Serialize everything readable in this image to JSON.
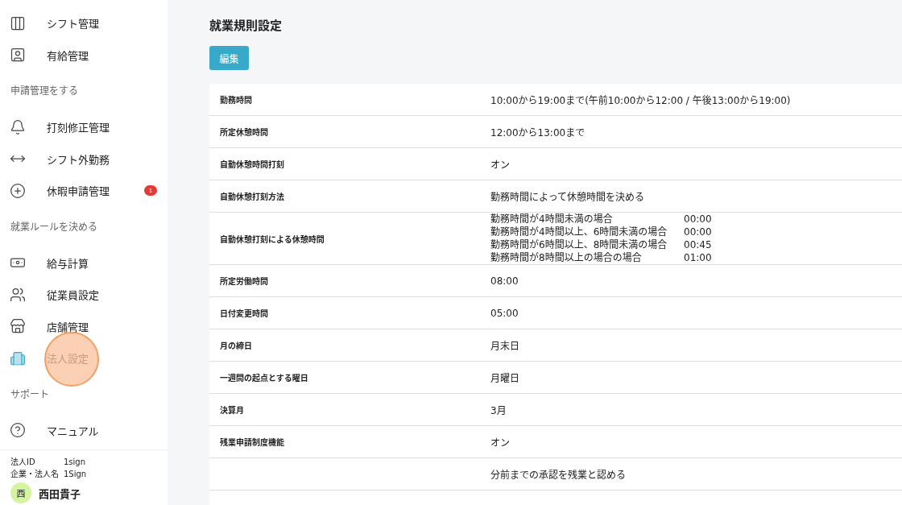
{
  "sidebar": {
    "sections": [
      {
        "items": [
          {
            "label": "シフト管理",
            "selected": false
          },
          {
            "label": "有給管理",
            "selected": false
          }
        ]
      },
      {
        "title": "申請管理をする",
        "items": [
          {
            "label": "打刻修正管理",
            "selected": false
          },
          {
            "label": "シフト外勤務",
            "selected": false
          },
          {
            "label": "休暇申請管理",
            "selected": false,
            "badge": "1"
          }
        ]
      },
      {
        "title": "就業ルールを決める",
        "items": [
          {
            "label": "給与計算",
            "selected": false
          },
          {
            "label": "従業員設定",
            "selected": false
          },
          {
            "label": "店舗管理",
            "selected": false
          },
          {
            "label": "法人設定",
            "selected": true
          }
        ]
      },
      {
        "title": "サポート",
        "items": [
          {
            "label": "マニュアル",
            "selected": false
          }
        ]
      }
    ],
    "account": {
      "rows": [
        {
          "label": "法人ID",
          "value": "1sign"
        },
        {
          "label": "企業・法人名",
          "value": "1Sign"
        }
      ],
      "user": {
        "initial": "西",
        "name": "西田貴子"
      }
    }
  },
  "main": {
    "title": "就業規則設定",
    "edit_button": "編集",
    "rows": [
      {
        "label": "勤務時間",
        "value": "10:00から19:00まで(午前10:00から12:00 / 午後13:00から19:00)"
      },
      {
        "label": "所定休憩時間",
        "value": "12:00から13:00まで"
      },
      {
        "label": "自動休憩時間打刻",
        "value": "オン"
      },
      {
        "label": "自動休憩打刻方法",
        "value": "勤務時間によって休憩時間を決める"
      },
      {
        "label": "自動休憩打刻による休憩時間",
        "lines": [
          {
            "condition": "勤務時間が4時間未満の場合",
            "time": "00:00"
          },
          {
            "condition": "勤務時間が4時間以上、6時間未満の場合",
            "time": "00:00"
          },
          {
            "condition": "勤務時間が6時間以上、8時間未満の場合",
            "time": "00:45"
          },
          {
            "condition": "勤務時間が8時間以上の場合の場合",
            "time": "01:00"
          }
        ]
      },
      {
        "label": "所定労働時間",
        "value": "08:00"
      },
      {
        "label": "日付変更時間",
        "value": "05:00"
      },
      {
        "label": "月の締日",
        "value": "月末日"
      },
      {
        "label": "一週間の起点とする曜日",
        "value": "月曜日"
      },
      {
        "label": "決算月",
        "value": "3月"
      },
      {
        "label": "残業申請制度機能",
        "value": "オン"
      },
      {
        "value": "分前までの承認を残業と認める"
      }
    ]
  }
}
